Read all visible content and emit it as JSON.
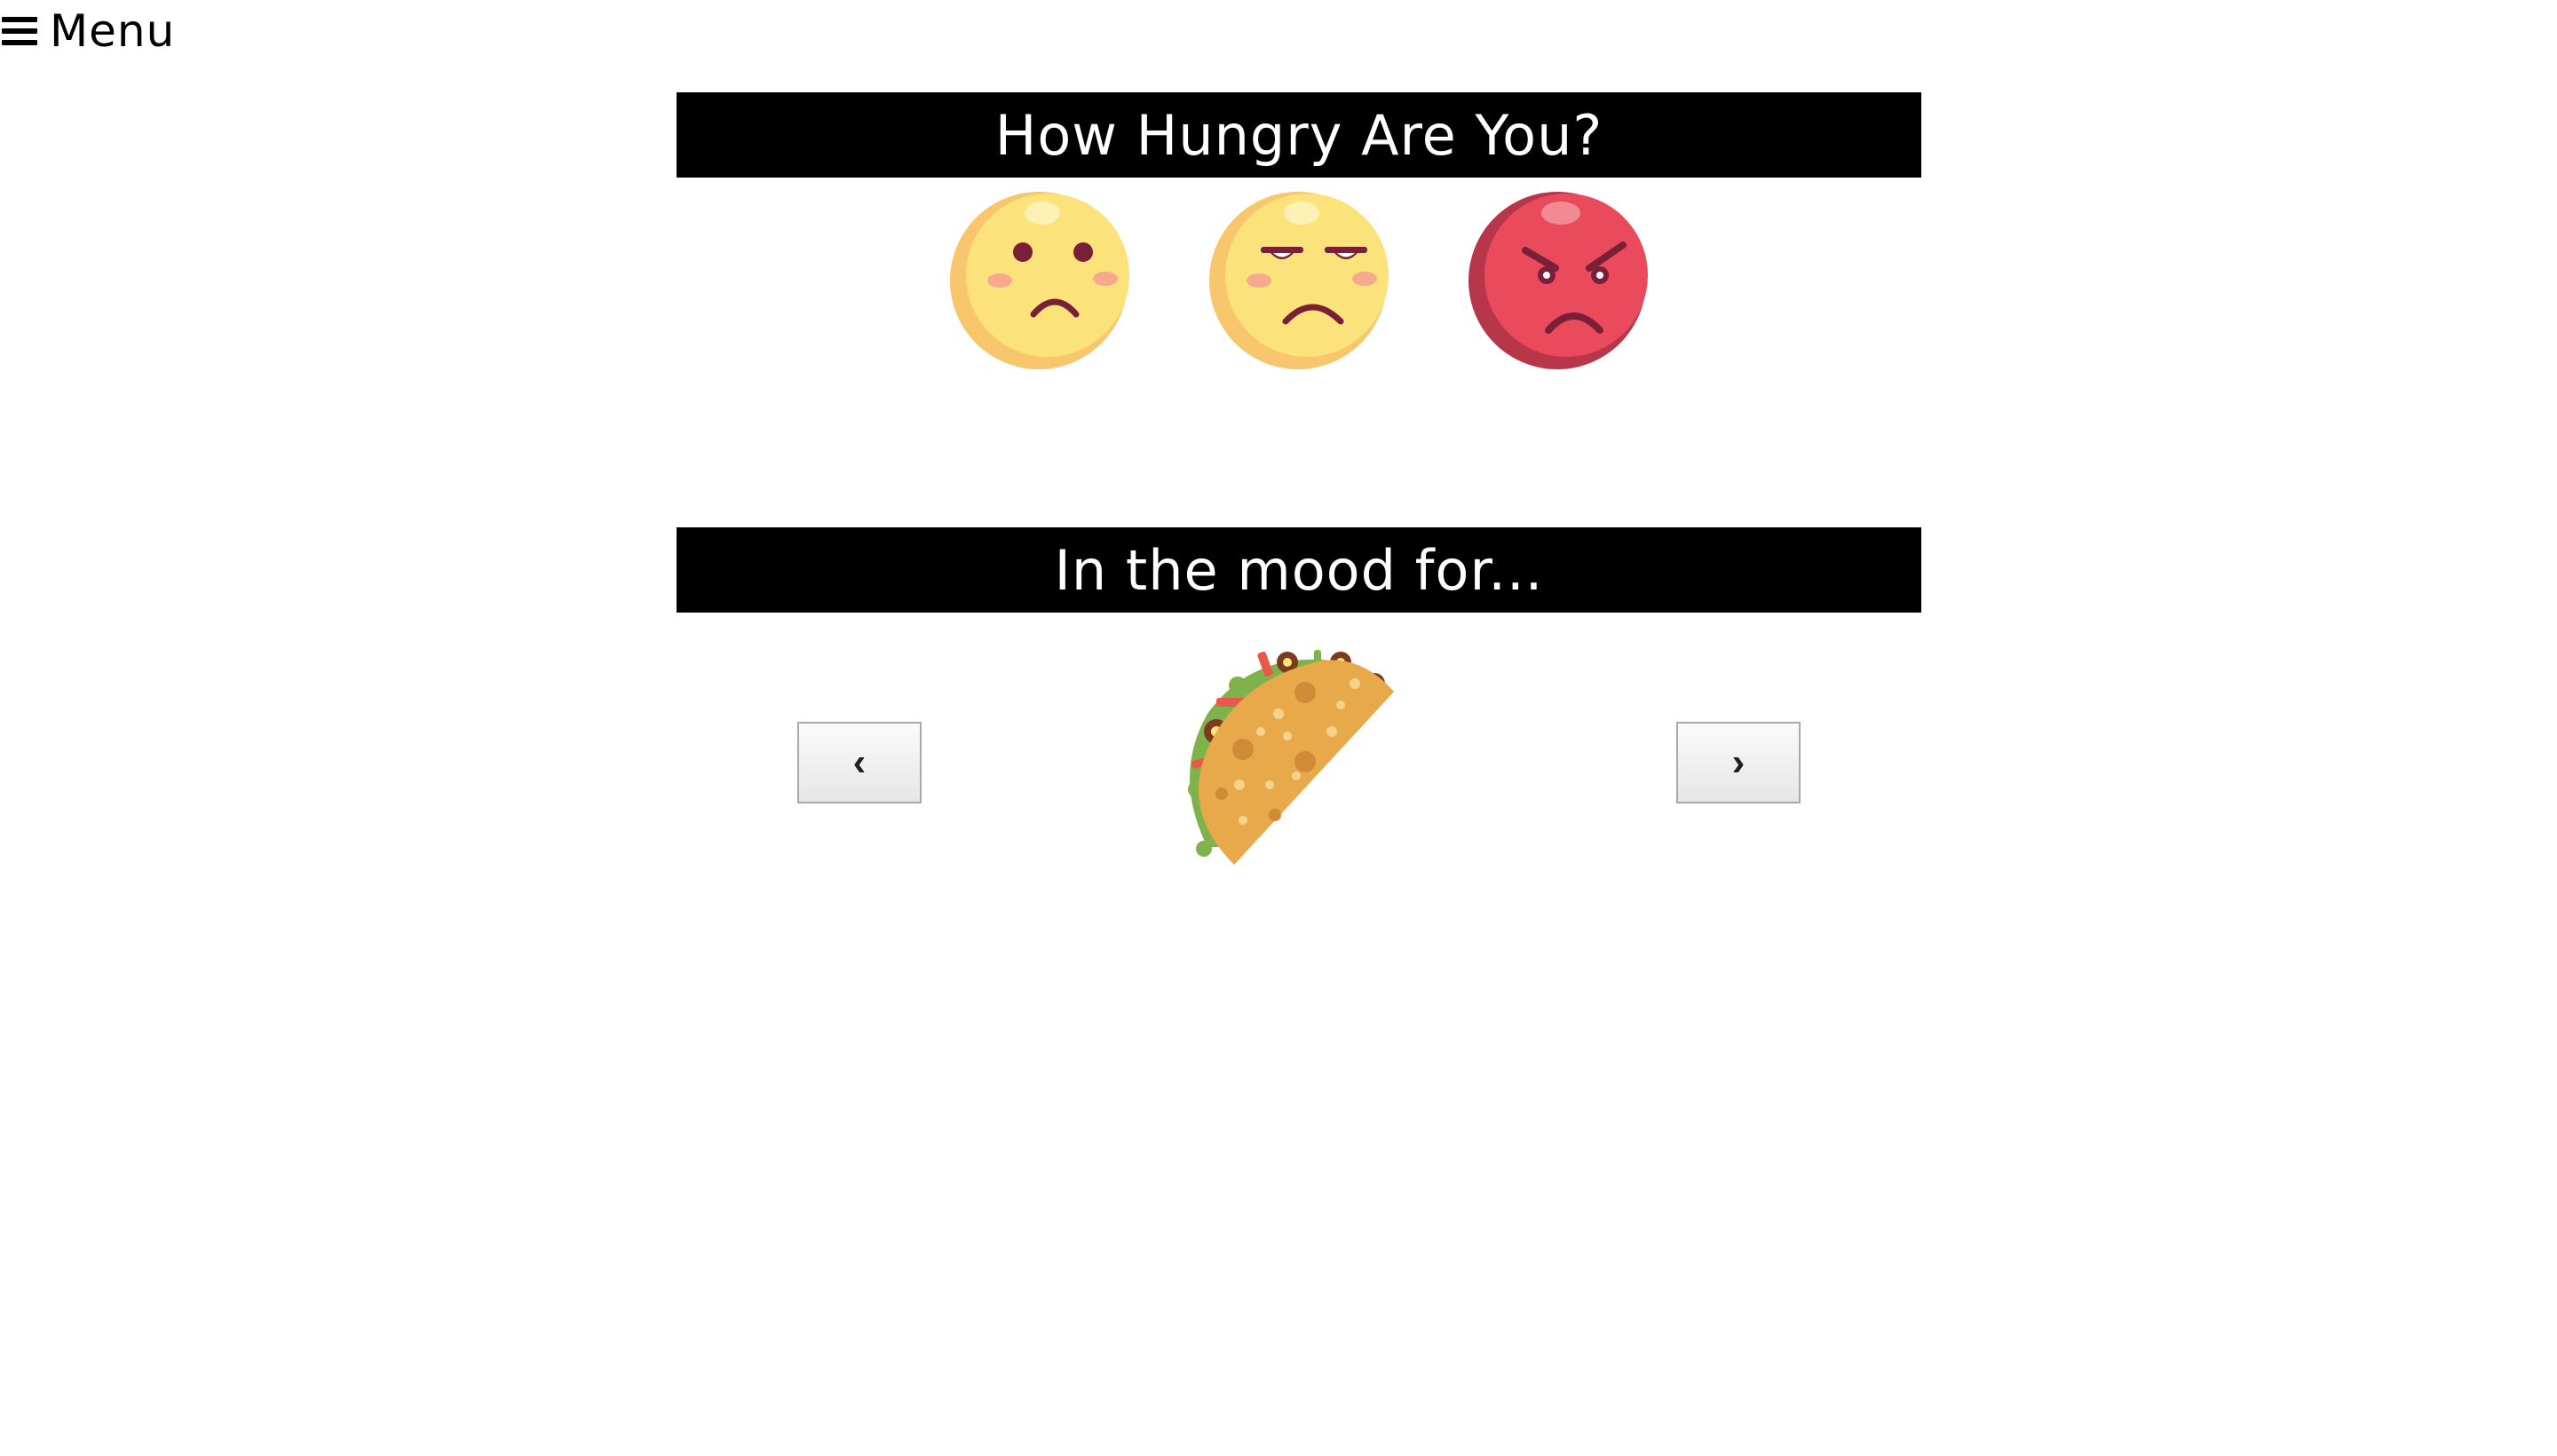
{
  "menu": {
    "label": "Menu",
    "icon": "hamburger-icon"
  },
  "hunger": {
    "title": "How Hungry Are You?",
    "options": [
      {
        "icon": "slightly-sad-face-icon",
        "color": "#FBE27A"
      },
      {
        "icon": "annoyed-face-icon",
        "color": "#FBE27A"
      },
      {
        "icon": "angry-face-icon",
        "color": "#E94A5C"
      }
    ]
  },
  "mood": {
    "title": "In the mood for...",
    "prev_label": "‹",
    "next_label": "›",
    "current_food_icon": "taco-icon"
  }
}
